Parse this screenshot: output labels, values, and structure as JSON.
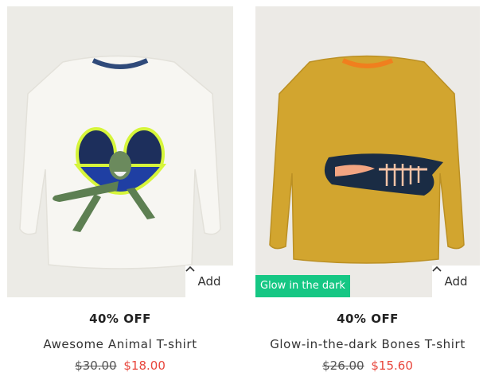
{
  "products": [
    {
      "discount": "40% OFF",
      "name": "Awesome Animal T-shirt",
      "old_price": "$30.00",
      "new_price": "$18.00",
      "add_label": "Add",
      "badge": null
    },
    {
      "discount": "40% OFF",
      "name": "Glow-in-the-dark Bones T-shirt",
      "old_price": "$26.00",
      "new_price": "$15.60",
      "add_label": "Add",
      "badge": "Glow in the dark"
    }
  ],
  "colors": {
    "sale_price": "#e8463c",
    "badge_bg": "#16c784",
    "image_bg": "#ece9e3"
  },
  "icons": [
    "chevron-up-icon"
  ]
}
